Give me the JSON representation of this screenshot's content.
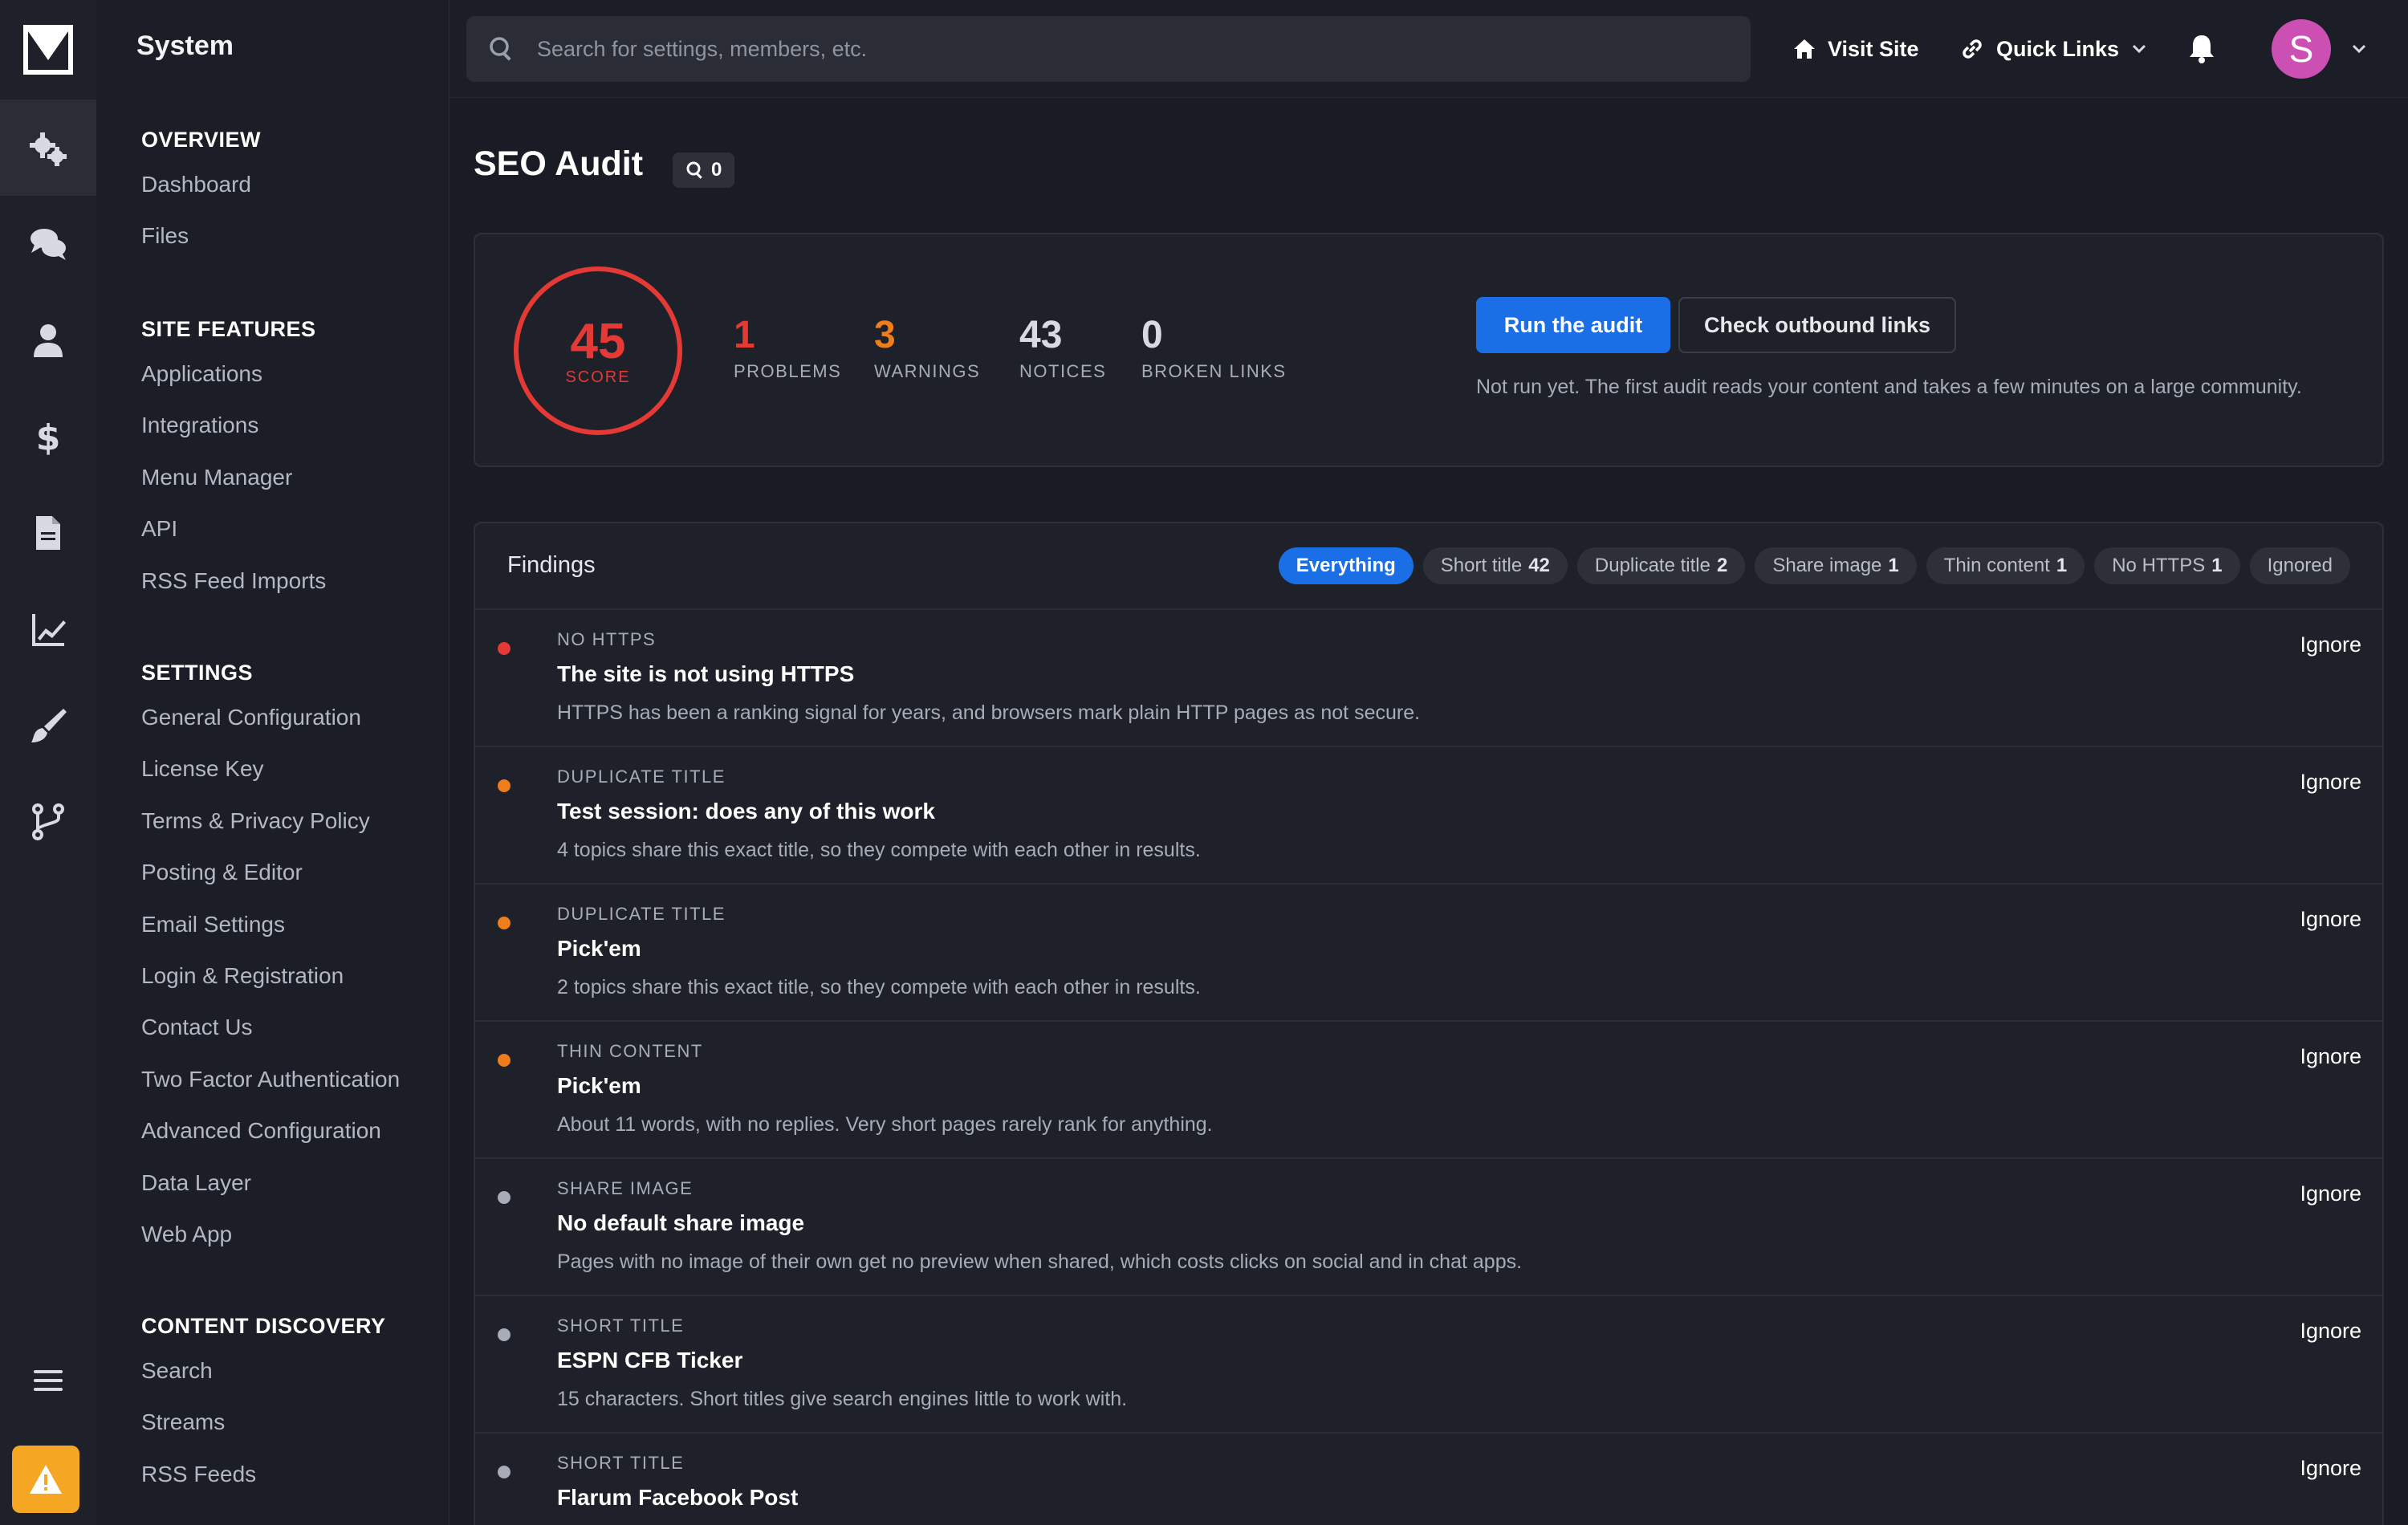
{
  "sidebar": {
    "title": "System",
    "sections": [
      {
        "heading": "OVERVIEW",
        "items": [
          "Dashboard",
          "Files"
        ]
      },
      {
        "heading": "SITE FEATURES",
        "items": [
          "Applications",
          "Integrations",
          "Menu Manager",
          "API",
          "RSS Feed Imports"
        ]
      },
      {
        "heading": "SETTINGS",
        "items": [
          "General Configuration",
          "License Key",
          "Terms & Privacy Policy",
          "Posting & Editor",
          "Email Settings",
          "Login & Registration",
          "Contact Us",
          "Two Factor Authentication",
          "Advanced Configuration",
          "Data Layer",
          "Web App"
        ]
      },
      {
        "heading": "CONTENT DISCOVERY",
        "items": [
          "Search",
          "Streams",
          "RSS Feeds"
        ]
      }
    ]
  },
  "topbar": {
    "search_placeholder": "Search for settings, members, etc.",
    "visit_site": "Visit Site",
    "quick_links": "Quick Links",
    "avatar_letter": "S"
  },
  "page": {
    "title": "SEO Audit",
    "badge_count": "0"
  },
  "score": {
    "value": "45",
    "label": "SCORE",
    "color": "#e53935",
    "stats": [
      {
        "value": "1",
        "label": "PROBLEMS",
        "color": "#e53935"
      },
      {
        "value": "3",
        "label": "WARNINGS",
        "color": "#ee7d1c"
      },
      {
        "value": "43",
        "label": "NOTICES",
        "color": "#d7dae0"
      },
      {
        "value": "0",
        "label": "BROKEN LINKS",
        "color": "#d7dae0"
      }
    ],
    "run_button": "Run the audit",
    "outbound_button": "Check outbound links",
    "note": "Not run yet. The first audit reads your content and takes a few minutes on a large community."
  },
  "findings": {
    "title": "Findings",
    "filters": [
      {
        "label": "Everything",
        "count": ""
      },
      {
        "label": "Short title",
        "count": "42"
      },
      {
        "label": "Duplicate title",
        "count": "2"
      },
      {
        "label": "Share image",
        "count": "1"
      },
      {
        "label": "Thin content",
        "count": "1"
      },
      {
        "label": "No HTTPS",
        "count": "1"
      },
      {
        "label": "Ignored",
        "count": ""
      }
    ],
    "ignore_label": "Ignore",
    "rows": [
      {
        "severity": "problem",
        "type": "NO HTTPS",
        "title": "The site is not using HTTPS",
        "desc": "HTTPS has been a ranking signal for years, and browsers mark plain HTTP pages as not secure."
      },
      {
        "severity": "warning",
        "type": "DUPLICATE TITLE",
        "title": "Test session: does any of this work",
        "desc": "4 topics share this exact title, so they compete with each other in results."
      },
      {
        "severity": "warning",
        "type": "DUPLICATE TITLE",
        "title": "Pick'em",
        "desc": "2 topics share this exact title, so they compete with each other in results."
      },
      {
        "severity": "warning",
        "type": "THIN CONTENT",
        "title": "Pick'em",
        "desc": "About 11 words, with no replies. Very short pages rarely rank for anything."
      },
      {
        "severity": "notice",
        "type": "SHARE IMAGE",
        "title": "No default share image",
        "desc": "Pages with no image of their own get no preview when shared, which costs clicks on social and in chat apps."
      },
      {
        "severity": "notice",
        "type": "SHORT TITLE",
        "title": "ESPN CFB Ticker",
        "desc": "15 characters. Short titles give search engines little to work with."
      },
      {
        "severity": "notice",
        "type": "SHORT TITLE",
        "title": "Flarum Facebook Post",
        "desc": ""
      }
    ]
  },
  "colors": {
    "accent": "#1a6fe6",
    "problem": "#e53935",
    "warning": "#ee7d1c",
    "notice": "#a7adb7",
    "alert": "#f5a623"
  },
  "icons": {
    "rail": [
      "cogs-icon",
      "chat-icon",
      "user-icon",
      "dollar-icon",
      "document-icon",
      "chart-icon",
      "brush-icon",
      "branch-icon"
    ],
    "rail_bottom": [
      "menu-icon",
      "warning-icon"
    ]
  }
}
